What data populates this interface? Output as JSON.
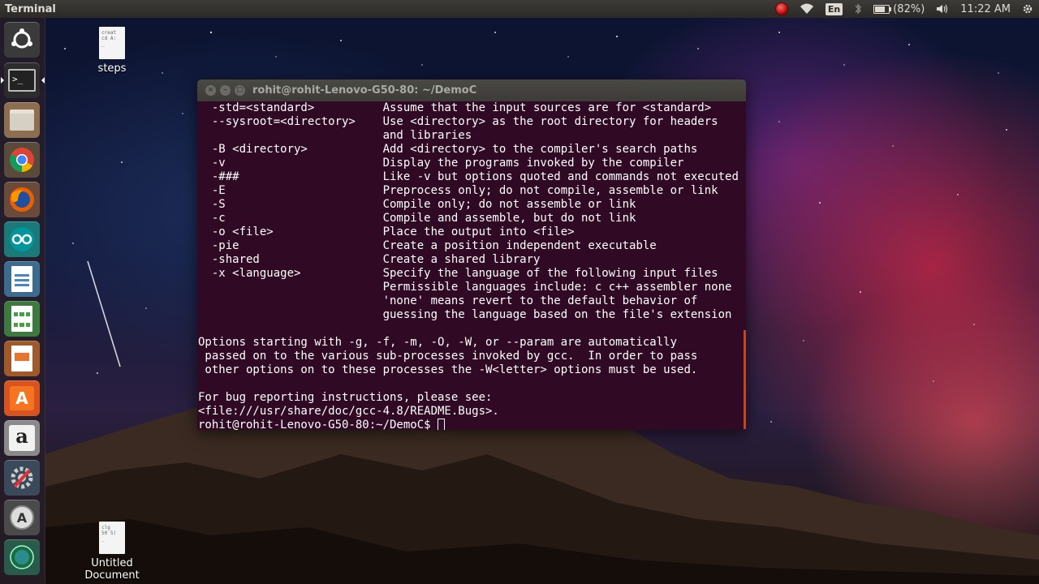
{
  "top_panel": {
    "app_title": "Terminal",
    "language": "En",
    "battery": "(82%)",
    "time": "11:22 AM"
  },
  "launcher": {
    "items": [
      {
        "name": "dash-home",
        "icon": "ubuntu-logo-icon"
      },
      {
        "name": "terminal",
        "icon": "terminal-icon"
      },
      {
        "name": "files",
        "icon": "file-manager-icon"
      },
      {
        "name": "chrome",
        "icon": "chrome-icon"
      },
      {
        "name": "firefox",
        "icon": "firefox-icon"
      },
      {
        "name": "arduino",
        "icon": "arduino-icon"
      },
      {
        "name": "writer",
        "icon": "writer-icon"
      },
      {
        "name": "calc",
        "icon": "calc-icon"
      },
      {
        "name": "impress",
        "icon": "impress-icon"
      },
      {
        "name": "software-center",
        "icon": "software-center-icon"
      },
      {
        "name": "amazon",
        "icon": "amazon-icon"
      },
      {
        "name": "system-settings",
        "icon": "settings-icon"
      },
      {
        "name": "software-updater",
        "icon": "updater-icon"
      },
      {
        "name": "workspace-switcher",
        "icon": "workspace-icon"
      }
    ]
  },
  "desktop_icons": {
    "steps": {
      "label": "steps",
      "preview": [
        "creat",
        "cd A:",
        "_"
      ]
    },
    "untitled": {
      "label": "Untitled Document",
      "preview": [
        "clg",
        "50 5(",
        "_"
      ]
    }
  },
  "terminal": {
    "title": "rohit@rohit-Lenovo-G50-80: ~/DemoC",
    "lines": [
      "  -std=<standard>          Assume that the input sources are for <standard>",
      "  --sysroot=<directory>    Use <directory> as the root directory for headers",
      "                           and libraries",
      "  -B <directory>           Add <directory> to the compiler's search paths",
      "  -v                       Display the programs invoked by the compiler",
      "  -###                     Like -v but options quoted and commands not executed",
      "  -E                       Preprocess only; do not compile, assemble or link",
      "  -S                       Compile only; do not assemble or link",
      "  -c                       Compile and assemble, but do not link",
      "  -o <file>                Place the output into <file>",
      "  -pie                     Create a position independent executable",
      "  -shared                  Create a shared library",
      "  -x <language>            Specify the language of the following input files",
      "                           Permissible languages include: c c++ assembler none",
      "                           'none' means revert to the default behavior of",
      "                           guessing the language based on the file's extension",
      "",
      "Options starting with -g, -f, -m, -O, -W, or --param are automatically",
      " passed on to the various sub-processes invoked by gcc.  In order to pass",
      " other options on to these processes the -W<letter> options must be used.",
      "",
      "For bug reporting instructions, please see:",
      "<file:///usr/share/doc/gcc-4.8/README.Bugs>."
    ],
    "prompt": "rohit@rohit-Lenovo-G50-80:~/DemoC$ "
  },
  "colors": {
    "terminal_bg": "#300a24",
    "panel_bg": "#3c3b37",
    "accent": "#e95420"
  }
}
